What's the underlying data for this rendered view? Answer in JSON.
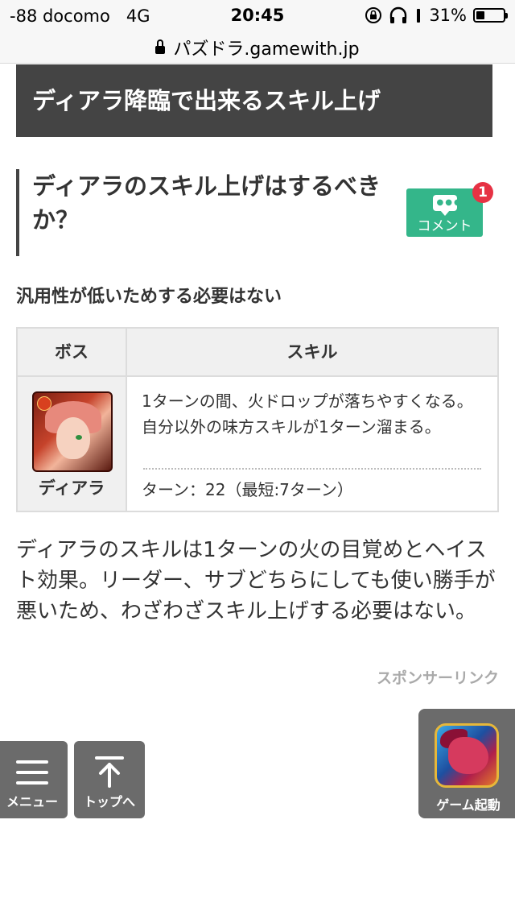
{
  "status_bar": {
    "carrier": "-88 docomo",
    "network": "4G",
    "time": "20:45",
    "battery_percent": "31%",
    "battery_level": 0.31
  },
  "browser": {
    "url": "パズドラ.gamewith.jp"
  },
  "section": {
    "heading": "ディアラ降臨で出来るスキル上げ"
  },
  "question": {
    "heading": "ディアラのスキル上げはするべきか？"
  },
  "comment": {
    "label": "コメント",
    "count": "1"
  },
  "summary": "汎用性が低いためする必要はない",
  "table": {
    "headers": {
      "boss": "ボス",
      "skill": "スキル"
    },
    "row": {
      "boss_name": "ディアラ",
      "skill_line1": "1ターンの間、火ドロップが落ちやすくなる。",
      "skill_line2": "自分以外の味方スキルが1ターン溜まる。",
      "turn": "ターン：22（最短:7ターン）"
    }
  },
  "body_text": "ディアラのスキルは1ターンの火の目覚めとヘイスト効果。リーダー、サブどちらにしても使い勝手が悪いため、わざわざスキル上げする必要はない。",
  "sponsor_label": "スポンサーリンク",
  "floating": {
    "menu_label": "メニュー",
    "top_label": "トップへ",
    "game_label": "ゲーム起動"
  },
  "colors": {
    "heading_bg": "#444444",
    "comment_green": "#34b68a",
    "badge_red": "#e63244",
    "float_gray": "#6b6b6b"
  }
}
